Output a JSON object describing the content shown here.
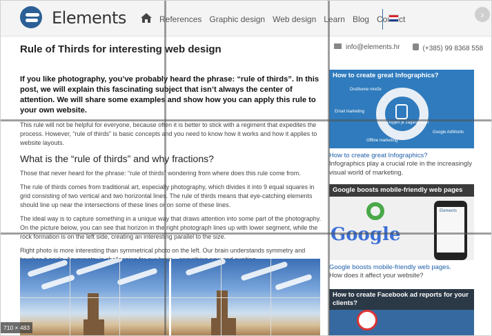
{
  "header": {
    "logo_text": "Elements",
    "nav": [
      "References",
      "Graphic design",
      "Web design",
      "Learn",
      "Blog",
      "Contact"
    ],
    "icons": {
      "home": "home-icon",
      "flag": "croatian-flag-icon",
      "close": "chevron-right-icon"
    }
  },
  "article": {
    "title": "Rule of Thirds for interesting web design",
    "lead": "If you like photography, you’ve probably heard the phrase: “rule of thirds”. In this post, we will explain this fascinating subject that isn’t always the center of attention. We will share some examples and show how you can apply this rule to your own website.",
    "p1": "This rule will not be helpful for everyone, because often it is better to stick with a regiment that expedites the process. However, “rule of thirds” is basic concepts and you need to know how it works and how it applies to website layouts.",
    "h2": "What is the “rule of thirds” and why fractions?",
    "p2": "Those that never heard for the phrase: “rule of thirds” wondering from where does this rule come from.",
    "p3": "The rule of thirds comes from traditional art, especially photography, which divides it into 9 equal squares in grid consisting of two vertical and two horizontal lines. The rule of thirds means that eye-catching elements should line up near the intersections of these lines or on some of these lines.",
    "p4": "The ideal way is to capture something in a unique way that draws attention into some part of the photography. On the picture below, you can see that horizon in the right photograph lines up with lower segment, while the rock formation is on the left side, creating an interesting parallel to the size.",
    "p5": "Right photo is more interesting than symmetrical photo on the left. Our brain understands symmetry and brushes it aside. Asymmetry is challenging for our brain – something new and exciting."
  },
  "sidebar": {
    "email": "info@elements.hr",
    "phone": "(+385) 99 8368 558",
    "cards": [
      {
        "head": "How to create great Infographics?",
        "link": "How to create great Infographics?",
        "desc": "Infographics play a crucial role in the increasingly visual world of marketing.",
        "labels": [
          "Društvene mreže",
          "Email marketing",
          "Uspjeh je zagarantiran",
          "Offline marketing",
          "Google AdWords"
        ]
      },
      {
        "head": "Google boosts mobile-friendly web pages",
        "link": "Google boosts mobile-friendly web pages.",
        "desc": "How does it affect your website?",
        "image_text": "Google",
        "phone_brand": "Elements"
      },
      {
        "head": "How to create Facebook ad reports for your clients?"
      }
    ]
  },
  "badge": "710 × 483",
  "colors": {
    "accent": "#2f7bbd",
    "nav_divider": "#3a6ea5",
    "link": "#1f5fa8"
  }
}
